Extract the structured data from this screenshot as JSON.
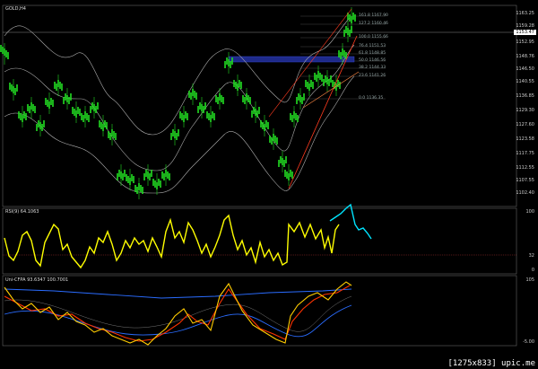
{
  "window": {
    "symbol_label": "GOLD,H4",
    "current_price": "1153.47"
  },
  "price_axis": [
    "1163.25",
    "1159.28",
    "1152.95",
    "1148.76",
    "1146.50",
    "1140.55",
    "1136.85",
    "1129.30",
    "1127.60",
    "1123.58",
    "1117.75",
    "1112.55",
    "1107.55",
    "1102.40"
  ],
  "fib_levels": [
    "161.8 1167.90",
    "127.2 1160.46",
    "100.0 1155.66",
    "76.4 1151.53",
    "61.8 1148.85",
    "50.0 1146.56",
    "38.2 1144.33",
    "23.6 1141.26",
    "0.0 1136.35"
  ],
  "rsi": {
    "label": "RSI(9) 64.1063",
    "axis": [
      "100",
      "32",
      "0"
    ]
  },
  "osc": {
    "label": "Uni-CFPA 93.6347 100.7001",
    "axis": [
      "105",
      "-5.00"
    ]
  },
  "colors": {
    "candles": "#22dd22",
    "bands": "#b0b0b0",
    "rsi_line": "#ffff00",
    "rsi_projection": "#00e5ff",
    "fib_zone": "#1e2a8a",
    "trendline": "#ff3b1f",
    "osc_fast": "#ffcc00",
    "osc_slow": "#ff3300",
    "osc_blue": "#2a6cff"
  },
  "watermark": "[1275x833] upic.me"
}
